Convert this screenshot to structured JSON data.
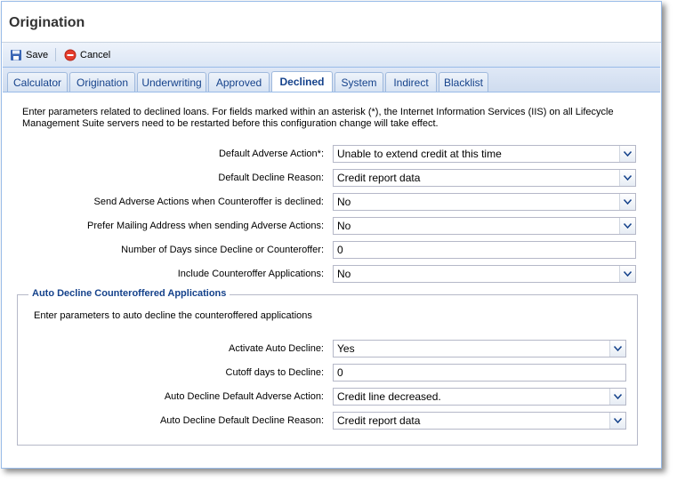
{
  "window": {
    "title": "Origination"
  },
  "toolbar": {
    "save_label": "Save",
    "cancel_label": "Cancel"
  },
  "tabs": [
    {
      "label": "Calculator"
    },
    {
      "label": "Origination"
    },
    {
      "label": "Underwriting"
    },
    {
      "label": "Approved"
    },
    {
      "label": "Declined"
    },
    {
      "label": "System"
    },
    {
      "label": "Indirect"
    },
    {
      "label": "Blacklist"
    }
  ],
  "active_tab": "Declined",
  "intro": "Enter parameters related to declined loans. For fields marked within an asterisk (*), the Internet Information Services (IIS) on all Lifecycle Management Suite servers need to be restarted before this configuration change will take effect.",
  "fields": [
    {
      "label": "Default Adverse Action*:",
      "value": "Unable to extend credit at this time"
    },
    {
      "label": "Default Decline Reason:",
      "value": "Credit report data"
    },
    {
      "label": "Send Adverse Actions when Counteroffer is declined:",
      "value": "No"
    },
    {
      "label": "Prefer Mailing Address when sending Adverse Actions:",
      "value": "No"
    },
    {
      "label": "Number of Days since Decline or Counteroffer:",
      "value": "0"
    },
    {
      "label": "Include Counteroffer Applications:",
      "value": "No"
    }
  ],
  "auto_decline": {
    "legend": "Auto Decline Counteroffered Applications",
    "intro": "Enter parameters to auto decline the counteroffered applications",
    "fields": [
      {
        "label": "Activate Auto Decline:",
        "value": "Yes"
      },
      {
        "label": "Cutoff days to Decline:",
        "value": "0"
      },
      {
        "label": "Auto Decline Default Adverse Action:",
        "value": "Credit line decreased."
      },
      {
        "label": "Auto Decline Default Decline Reason:",
        "value": "Credit report data"
      }
    ]
  },
  "colors": {
    "border": "#99bbe8",
    "tab_text": "#15428b",
    "legend": "#15428b"
  }
}
